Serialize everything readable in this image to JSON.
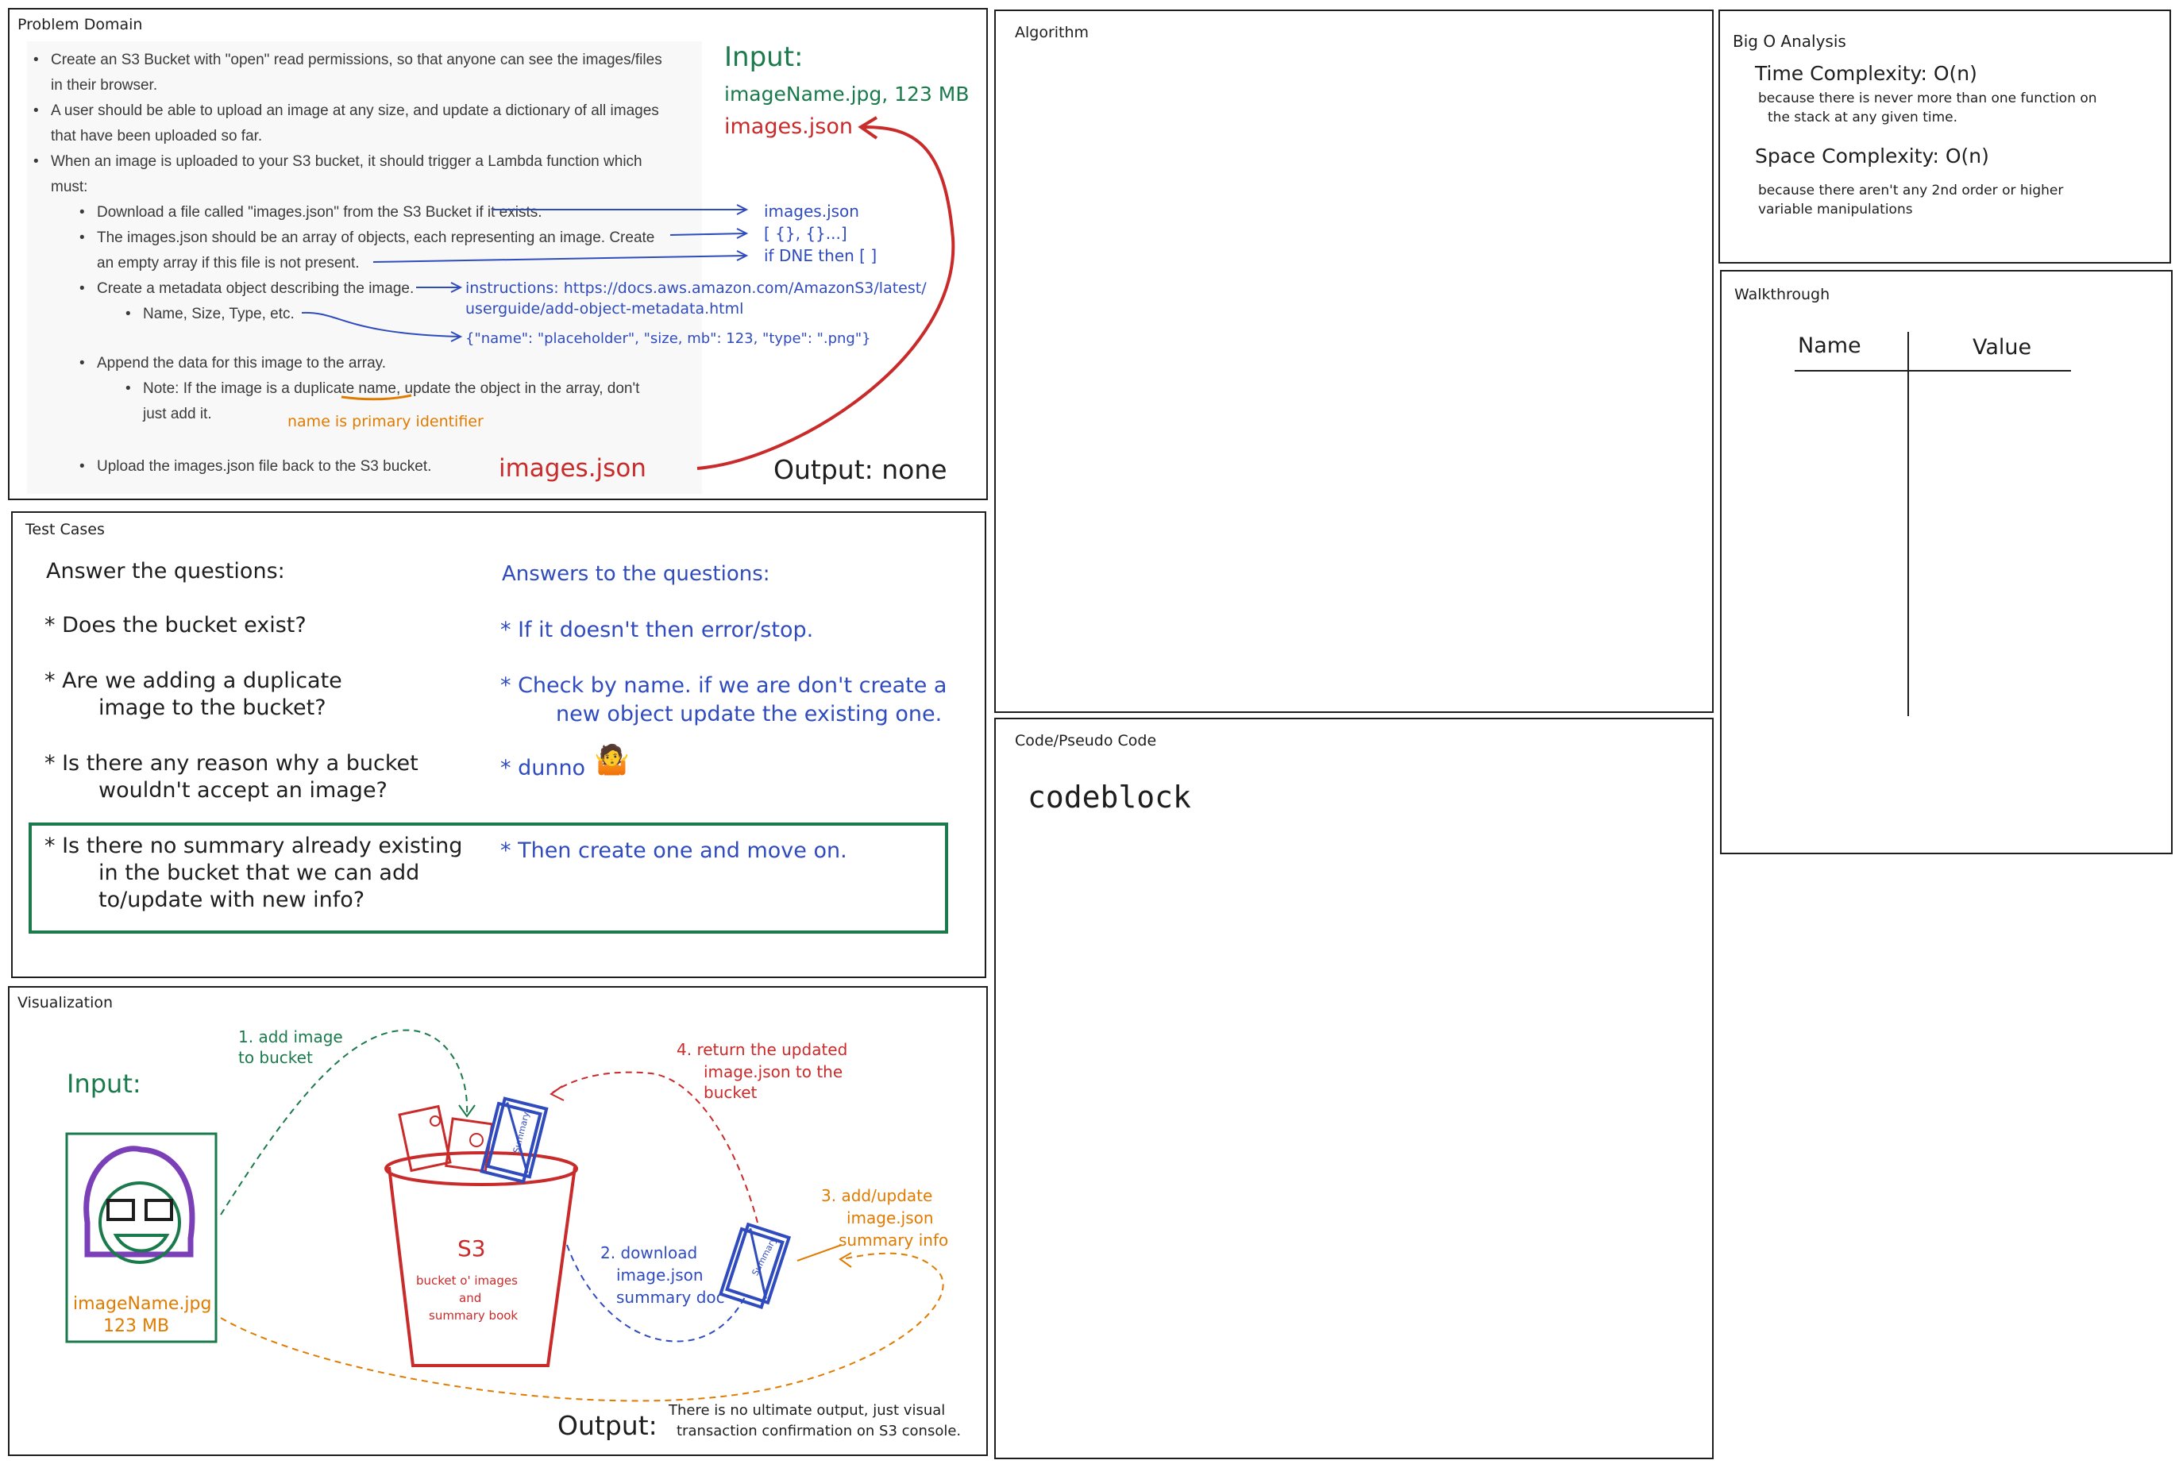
{
  "panels": {
    "problem_domain": "Problem Domain",
    "algorithm": "Algorithm",
    "big_o": "Big O Analysis",
    "walkthrough": "Walkthrough",
    "test_cases": "Test Cases",
    "code": "Code/Pseudo Code",
    "visualization": "Visualization"
  },
  "problem_domain": {
    "items": [
      "Create an S3 Bucket with \"open\" read permissions, so that anyone can see the images/files",
      "in their browser.",
      "A user should be able to upload an image at any size, and update a dictionary of all images",
      "that have been uploaded so far.",
      "When an image is uploaded to your S3 bucket, it should trigger a Lambda function which",
      "must:",
      "Download a file called \"images.json\" from the S3 Bucket if it exists.",
      "The images.json should be an array of objects, each representing an image. Create",
      "an empty array if this file is not present.",
      "Create a metadata object describing the image.",
      "Name, Size, Type, etc.",
      "Append the data for this image to the array.",
      "Note: If the image is a duplicate name, update the object in the array, don't",
      "just add it.",
      "Upload the images.json file back to the S3 bucket."
    ],
    "input_label": "Input:",
    "input_value": "imageName.jpg, 123 MB",
    "input_json": "images.json",
    "note_images_json": "images.json",
    "note_array": "[ {}, {}...]",
    "note_dne": "if DNE then [ ]",
    "note_instructions_1": "instructions: https://docs.aws.amazon.com/AmazonS3/latest/",
    "note_instructions_2": "userguide/add-object-metadata.html",
    "note_object": "{\"name\": \"placeholder\", \"size, mb\": 123, \"type\": \".png\"}",
    "note_primary": "name is primary identifier",
    "output_json": "images.json",
    "output_label": "Output: none"
  },
  "big_o": {
    "time": "Time Complexity: O(n)",
    "time_note_1": "because there is never more than one function on",
    "time_note_2": "the stack at any given time.",
    "space": "Space Complexity: O(n)",
    "space_note_1": "because there aren't any 2nd order or higher",
    "space_note_2": "variable manipulations"
  },
  "walkthrough": {
    "col_name": "Name",
    "col_value": "Value"
  },
  "test_cases": {
    "questions_heading": "Answer the questions:",
    "answers_heading": "Answers to the questions:",
    "q1": "* Does the bucket exist?",
    "q2a": "* Are we adding a duplicate",
    "q2b": "image to the bucket?",
    "q3a": "* Is there any reason why a bucket",
    "q3b": "wouldn't accept an image?",
    "q4a": "* Is there no summary already existing",
    "q4b": "in the bucket that we can add",
    "q4c": "to/update with new info?",
    "a1": "* If it doesn't then error/stop.",
    "a2a": "* Check by name. if we are don't create a",
    "a2b": "new object update the existing one.",
    "a3": "* dunno",
    "a4": "* Then create one and move on."
  },
  "code": {
    "content": "codeblock"
  },
  "visualization": {
    "input_label": "Input:",
    "image_name": "imageName.jpg",
    "image_size": "123 MB",
    "step1a": "1. add image",
    "step1b": "to bucket",
    "step2a": "2. download",
    "step2b": "image.json",
    "step2c": "summary doc",
    "step3a": "3. add/update",
    "step3b": "image.json",
    "step3c": "summary info",
    "step4a": "4. return the updated",
    "step4b": "image.json to the",
    "step4c": "bucket",
    "bucket_title": "S3",
    "bucket_sub1": "bucket o' images",
    "bucket_sub2": "and",
    "bucket_sub3": "summary book",
    "book_label": "Summary",
    "output_label": "Output:",
    "output_note_1": "There is no ultimate output, just visual",
    "output_note_2": "transaction confirmation on S3 console."
  },
  "colors": {
    "green": "#1a7a4c",
    "red": "#c92a2a",
    "blue": "#2f4bbd",
    "orange": "#e07b00",
    "purple": "#7b3fb8"
  },
  "icons": [
    "shrug-emoji-icon",
    "person-drawing-icon",
    "bucket-icon",
    "book-icon"
  ]
}
